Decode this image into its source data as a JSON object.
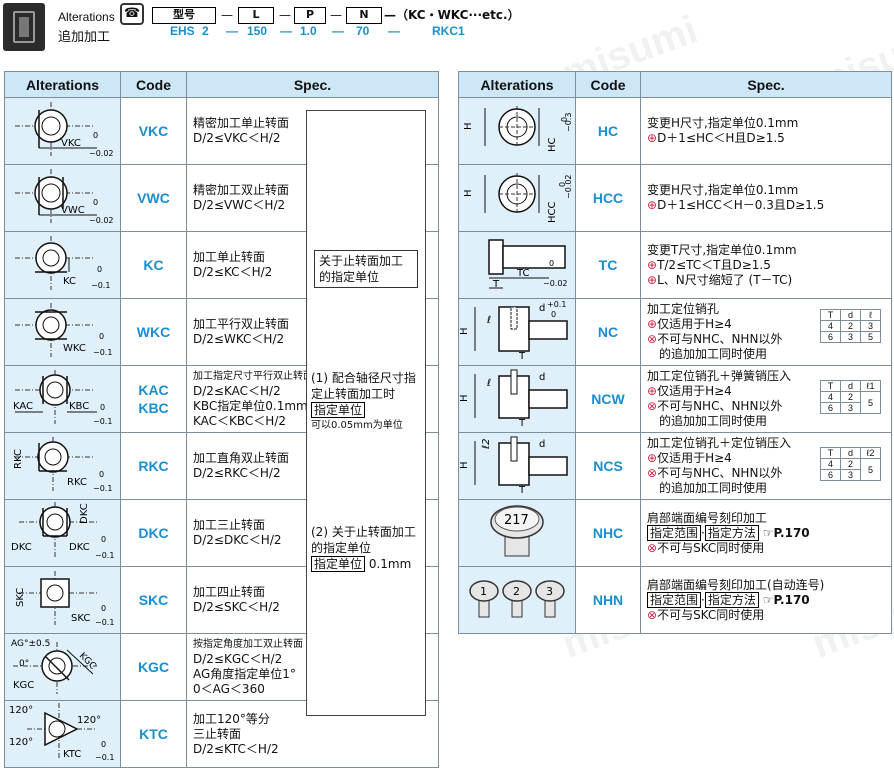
{
  "header": {
    "alterations_en": "Alterations",
    "alterations_zh": "追加加工",
    "code_fields": [
      "型号",
      "L",
      "P",
      "N"
    ],
    "dash": "—",
    "suffix": "—（KC・WKC···etc.）",
    "example": [
      "EHS",
      "2",
      "—",
      "150",
      "—",
      "1.0",
      "—",
      "70",
      "—",
      "RKC1"
    ]
  },
  "columns": {
    "alterations": "Alterations",
    "code": "Code",
    "spec": "Spec."
  },
  "watermark": "misumi",
  "left_rows": [
    {
      "code": "VKC",
      "spec": [
        "精密加工单止转面",
        "D/2≤VKC＜H/2"
      ],
      "fig": {
        "label": "VKC",
        "tol_top": "0",
        "tol_bot": "−0.02"
      }
    },
    {
      "code": "VWC",
      "spec": [
        "精密加工双止转面",
        "D/2≤VWC＜H/2"
      ],
      "fig": {
        "label": "VWC",
        "tol_top": "0",
        "tol_bot": "−0.02"
      }
    },
    {
      "code": "KC",
      "spec": [
        "加工单止转面",
        "D/2≤KC＜H/2"
      ],
      "fig": {
        "label": "KC",
        "tol_top": "0",
        "tol_bot": "−0.1"
      }
    },
    {
      "code": "WKC",
      "spec": [
        "加工平行双止转面",
        "D/2≤WKC＜H/2"
      ],
      "fig": {
        "label": "WKC",
        "tol_top": "0",
        "tol_bot": "−0.1"
      }
    },
    {
      "code": "KAC\nKBC",
      "spec": [
        "加工指定尺寸平行双止转面",
        "D/2≤KAC＜H/2",
        "KBC指定单位0.1mm",
        "KAC＜KBC＜H/2"
      ],
      "fig": {
        "label": "KBC",
        "label2": "KAC",
        "tol_top": "0",
        "tol_bot": "−0.1"
      }
    },
    {
      "code": "RKC",
      "spec": [
        "加工直角双止转面",
        "D/2≤RKC＜H/2"
      ],
      "fig": {
        "label": "RKC",
        "label2": "RKC",
        "tol_top": "0",
        "tol_bot": "−0.1"
      }
    },
    {
      "code": "DKC",
      "spec": [
        "加工三止转面",
        "D/2≤DKC＜H/2"
      ],
      "fig": {
        "label": "DKC",
        "label2": "DKC",
        "label3": "DKC",
        "tol_top": "0",
        "tol_bot": "−0.1"
      }
    },
    {
      "code": "SKC",
      "spec": [
        "加工四止转面",
        "D/2≤SKC＜H/2"
      ],
      "fig": {
        "label": "SKC",
        "label2": "SKC",
        "tol_top": "0",
        "tol_bot": "−0.1"
      }
    },
    {
      "code": "KGC",
      "spec": [
        "按指定角度加工双止转面",
        "D/2≤KGC＜H/2",
        "AG角度指定单位1°",
        "0＜AG＜360"
      ],
      "fig": {
        "label": "KGC",
        "label2": "KGC",
        "ag": "AG°±0.5",
        "zero": "0°",
        "tol_top": "0",
        "tol_bot": "−0.1"
      }
    },
    {
      "code": "KTC",
      "spec": [
        "加工120°等分",
        "三止转面",
        "D/2≤KTC＜H/2"
      ],
      "fig": {
        "label": "KTC",
        "a1": "120°",
        "a2": "120°",
        "a3": "120°",
        "tol_top": "0",
        "tol_bot": "−0.1"
      }
    }
  ],
  "notes": {
    "n1": "关于止转面加工的指定单位",
    "n2a": "(1) 配合轴径尺寸指定止转面加工时",
    "n2b": "指定单位",
    "n2c": "可以0.05mm为单位",
    "n3a": "(2) 关于止转面加工的指定单位",
    "n3b": "指定单位",
    "n3c": "0.1mm"
  },
  "right_rows": [
    {
      "code": "HC",
      "spec": [
        "变更H尺寸,指定单位0.1mm",
        "D＋1≤HC＜H且D≥1.5"
      ],
      "fig": {
        "h": "H",
        "label": "HC",
        "tol_top": "0",
        "tol_bot": "−0.3"
      }
    },
    {
      "code": "HCC",
      "spec": [
        "变更H尺寸,指定单位0.1mm",
        "D＋1≤HCC＜H－0.3且D≥1.5"
      ],
      "fig": {
        "h": "H",
        "label": "HCC",
        "tol_top": "0",
        "tol_bot": "−0.02"
      }
    },
    {
      "code": "TC",
      "spec": [
        "变更T尺寸,指定单位0.1mm",
        "T/2≤TC＜T且D≥1.5",
        "L、N尺寸缩短了 (T－TC)"
      ],
      "fig": {
        "label": "TC",
        "t": "T",
        "tol_top": "0",
        "tol_bot": "−0.02"
      }
    },
    {
      "code": "NC",
      "spec": [
        "加工定位销孔",
        "仅适用于H≥4",
        "不可与NHC、NHN以外",
        "的追加加工同时使用"
      ],
      "fig": {
        "h": "H",
        "l": "ℓ",
        "d": "d",
        "t": "T",
        "tol": "+0.1",
        "tol2": "0"
      },
      "mini": {
        "head": [
          "T",
          "d",
          "ℓ"
        ],
        "rows": [
          [
            "4",
            "2",
            "3"
          ],
          [
            "6",
            "3",
            "5"
          ]
        ]
      }
    },
    {
      "code": "NCW",
      "spec": [
        "加工定位销孔＋弹簧销压入",
        "仅适用于H≥4",
        "不可与NHC、NHN以外",
        "的追加加工同时使用"
      ],
      "fig": {
        "h": "H",
        "l": "ℓ",
        "d": "d",
        "t": "T"
      },
      "mini": {
        "head": [
          "T",
          "d",
          "ℓ1"
        ],
        "rows": [
          [
            "4",
            "2",
            "5"
          ],
          [
            "6",
            "3",
            ""
          ]
        ]
      }
    },
    {
      "code": "NCS",
      "spec": [
        "加工定位销孔＋定位销压入",
        "仅适用于H≥4",
        "不可与NHC、NHN以外",
        "的追加加工同时使用"
      ],
      "fig": {
        "h": "H",
        "l": "ℓ2",
        "d": "d",
        "t": "T"
      },
      "mini": {
        "head": [
          "T",
          "d",
          "ℓ2"
        ],
        "rows": [
          [
            "4",
            "2",
            "5"
          ],
          [
            "6",
            "3",
            ""
          ]
        ]
      }
    },
    {
      "code": "NHC",
      "spec": [
        "肩部端面编号刻印加工",
        "指定范围",
        "指定方法",
        "P.170",
        "不可与SKC同时使用"
      ],
      "fig": {
        "num": "217"
      }
    },
    {
      "code": "NHN",
      "spec": [
        "肩部端面编号刻印加工(自动连号)",
        "指定范围",
        "指定方法",
        "P.170",
        "不可与SKC同时使用"
      ],
      "fig": {
        "n1": "1",
        "n2": "2",
        "n3": "3"
      }
    }
  ]
}
